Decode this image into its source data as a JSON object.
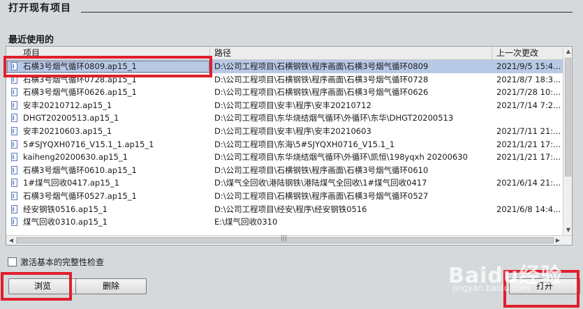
{
  "dialog": {
    "title": "打开现有项目",
    "recent_label": "最近使用的"
  },
  "table": {
    "columns": [
      "项目",
      "路径",
      "上一次更改"
    ],
    "rows": [
      {
        "name": "石横3号烟气循环0809.ap15_1",
        "path": "D:\\公司工程项目\\石横钢铁\\程序画面\\石横3号烟气循环0809",
        "date": "2021/9/5 15:4..."
      },
      {
        "name": "石横3号烟气循环0728.ap15_1",
        "path": "D:\\公司工程项目\\石横钢铁\\程序画面\\石横3号烟气循环0728",
        "date": "2021/8/7 18:3..."
      },
      {
        "name": "石横3号烟气循环0626.ap15_1",
        "path": "D:\\公司工程项目\\石横钢铁\\程序画面\\石横3号烟气循环0626",
        "date": "2021/7/28 10:..."
      },
      {
        "name": "安丰20210712.ap15_1",
        "path": "D:\\公司工程项目\\安丰\\程序\\安丰20210712",
        "date": "2021/7/14 7:2..."
      },
      {
        "name": "DHGT20200513.ap15_1",
        "path": "D:\\公司工程项目\\东华烧结烟气循环\\外循环\\东华\\DHGT20200513",
        "date": ""
      },
      {
        "name": "安丰20210603.ap15_1",
        "path": "D:\\公司工程项目\\安丰\\程序\\安丰20210603",
        "date": "2021/7/11 21:..."
      },
      {
        "name": "5#SJYQXH0716_V15.1_1.ap15_1",
        "path": "D:\\公司工程项目\\东海\\5#SJYQXH0716_V15.1_1",
        "date": "2021/1/21 17:..."
      },
      {
        "name": "kaiheng20200630.ap15_1",
        "path": "D:\\公司工程项目\\东华烧结烟气循环\\外循环\\凯恒\\198yqxh 20200630",
        "date": "2021/1/21 17:..."
      },
      {
        "name": "石横3号烟气循环0610.ap15_1",
        "path": "D:\\公司工程项目\\石横钢铁\\程序画面\\石横3号烟气循环0610",
        "date": ""
      },
      {
        "name": "1#煤气回收0417.ap15_1",
        "path": "D:\\煤气全回收\\港陆钢铁\\港陆煤气全回收\\1#煤气回收0417",
        "date": "2021/6/14 21:..."
      },
      {
        "name": "石横3号烟气循环0527.ap15_1",
        "path": "D:\\公司工程项目\\石横钢铁\\程序画面\\石横3号烟气循环0527",
        "date": ""
      },
      {
        "name": "经安钢铁0516.ap15_1",
        "path": "D:\\公司工程项目\\经安\\程序\\经安钢铁0516",
        "date": "2021/6/8 14:4..."
      },
      {
        "name": "煤气回收0310.ap15_1",
        "path": "E:\\煤气回收0310",
        "date": ""
      }
    ],
    "selected_index": 0
  },
  "checkbox": {
    "label": "激活基本的完整性检查",
    "checked": false
  },
  "buttons": {
    "browse": "浏览",
    "delete": "删除",
    "open": "打开"
  },
  "watermark": {
    "logo": "Baidu经验",
    "url": "jingyan.baidu.com"
  },
  "colors": {
    "selection": "#b8c9e6",
    "highlight": "#e01f2c",
    "background": "#d6d9dc"
  }
}
